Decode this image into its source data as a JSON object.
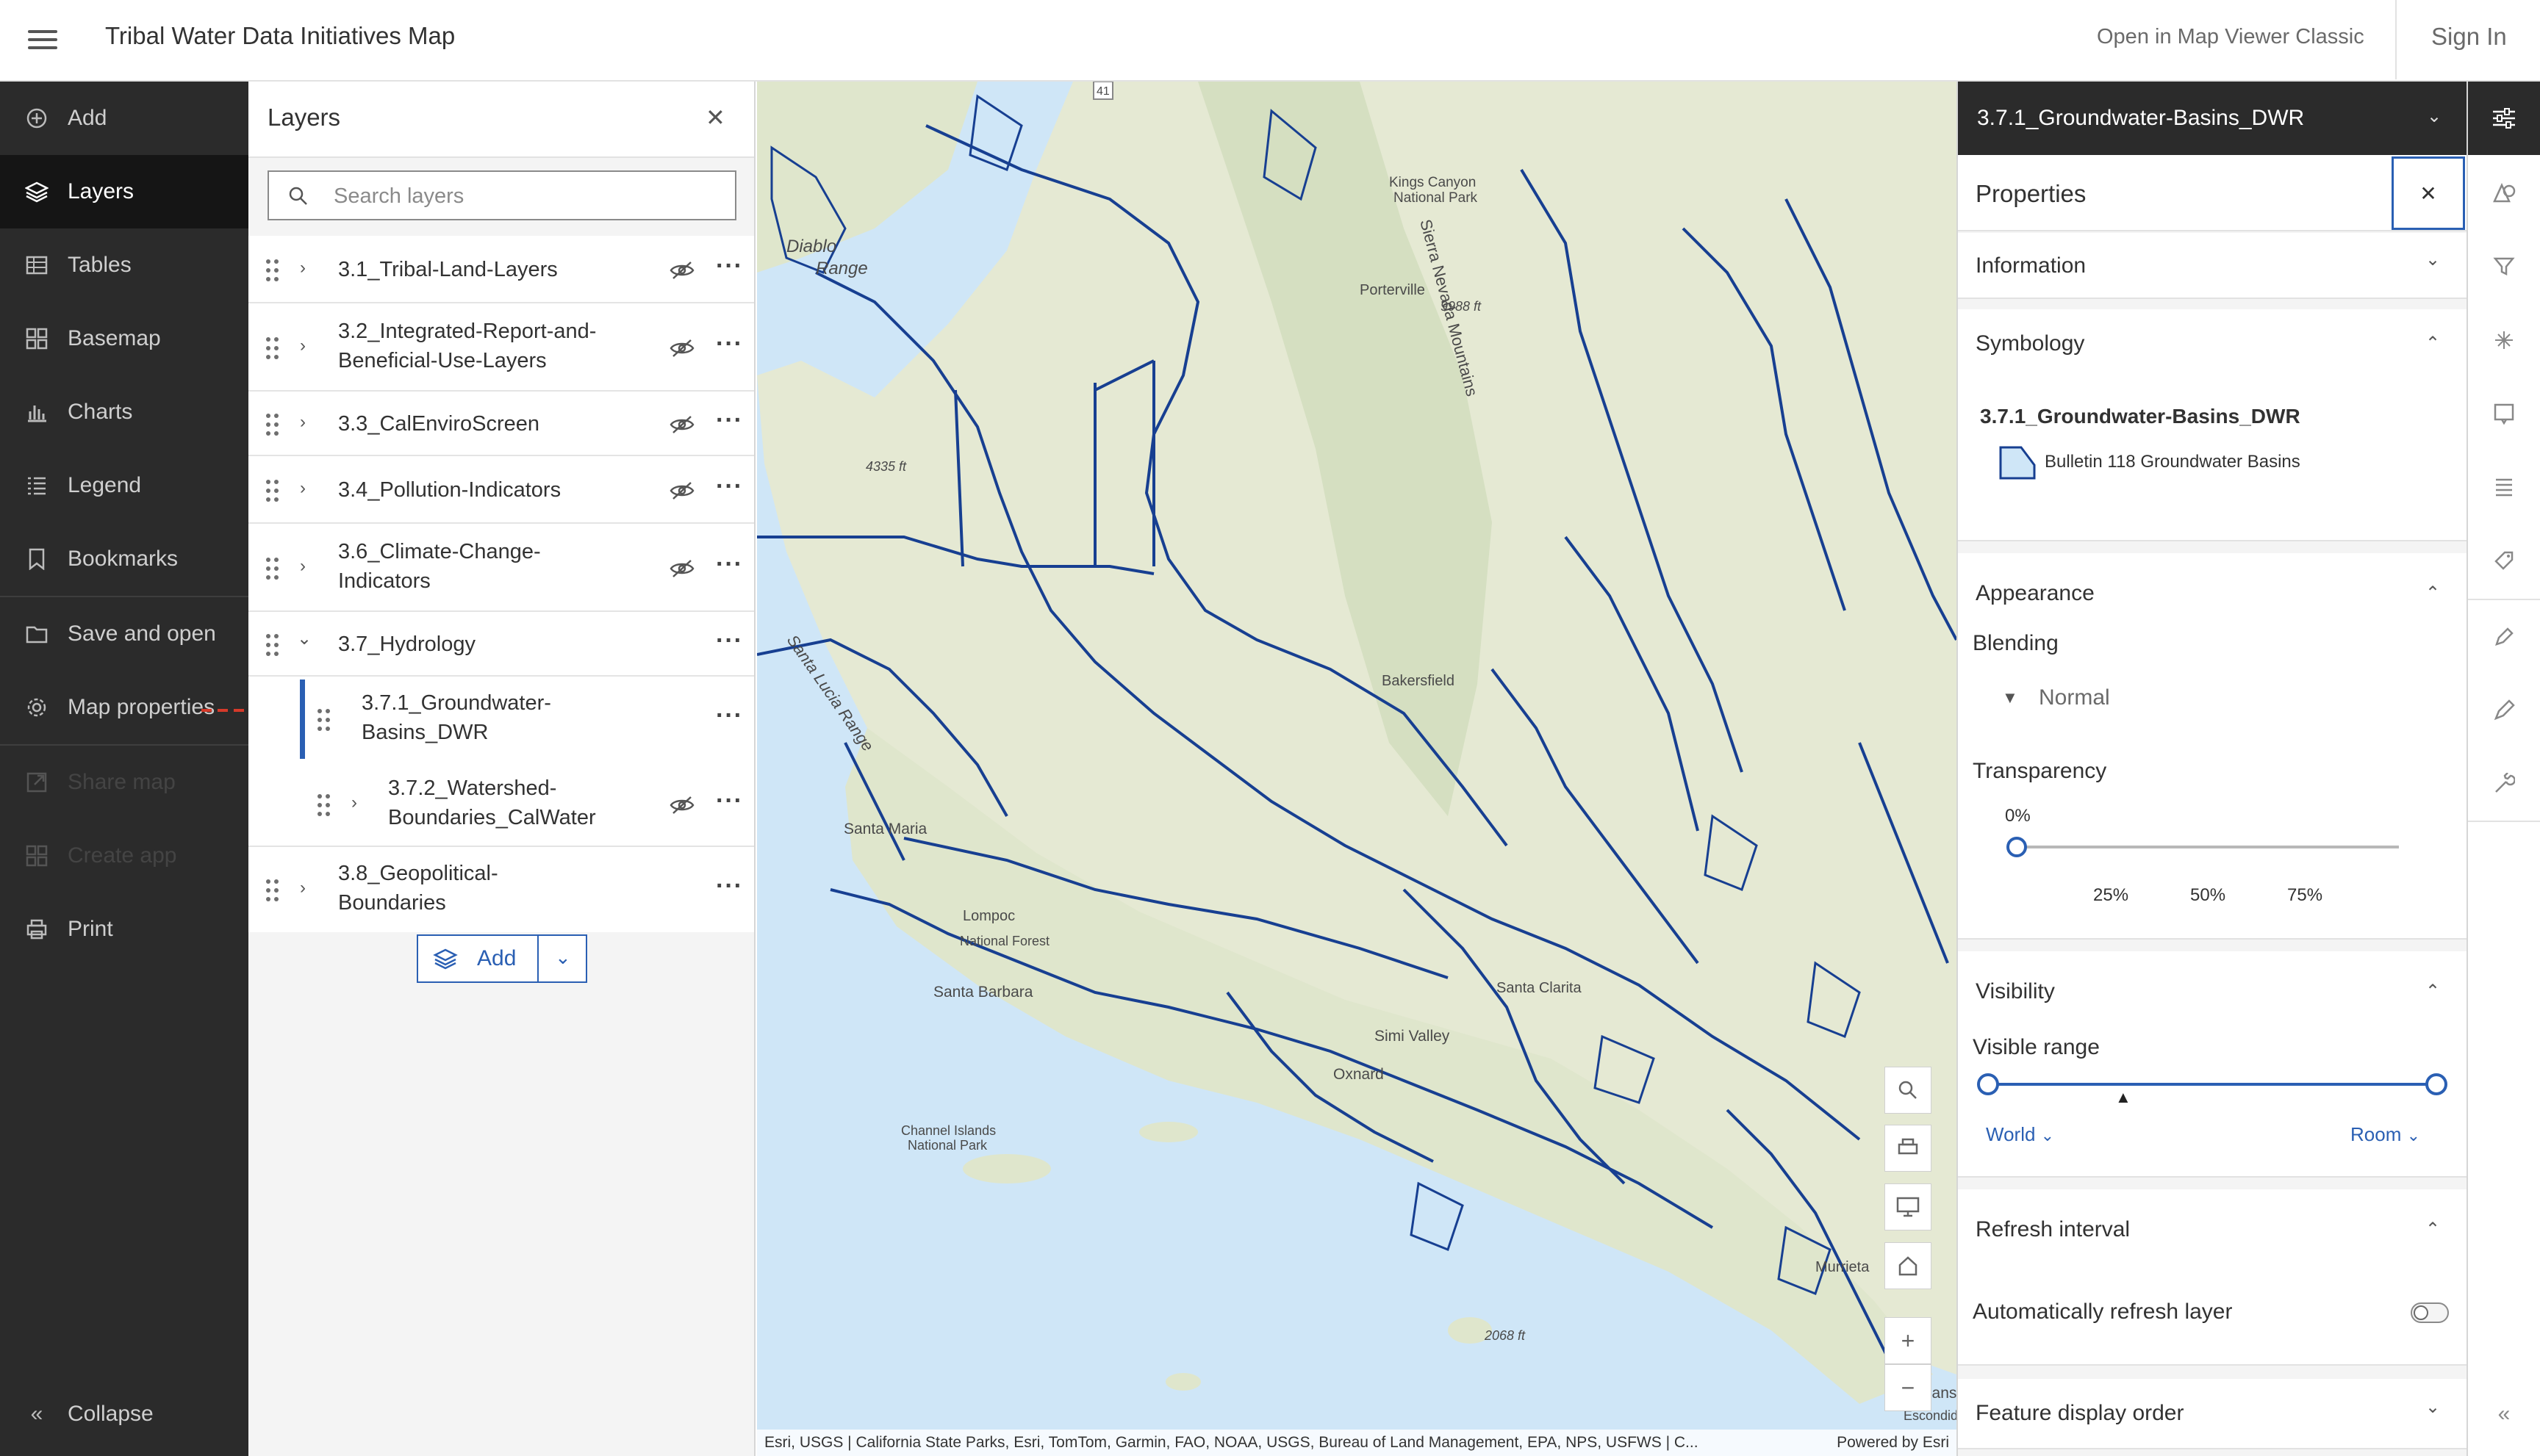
{
  "header": {
    "title": "Tribal Water Data Initiatives Map",
    "open_classic": "Open in Map Viewer Classic",
    "sign_in": "Sign In"
  },
  "nav": {
    "items": [
      {
        "label": "Add",
        "icon": "plus-circle-icon"
      },
      {
        "label": "Layers",
        "icon": "layers-icon"
      },
      {
        "label": "Tables",
        "icon": "table-icon"
      },
      {
        "label": "Basemap",
        "icon": "basemap-icon"
      },
      {
        "label": "Charts",
        "icon": "chart-icon"
      },
      {
        "label": "Legend",
        "icon": "legend-icon"
      },
      {
        "label": "Bookmarks",
        "icon": "bookmark-icon"
      },
      {
        "label": "Save and open",
        "icon": "folder-icon"
      },
      {
        "label": "Map properties",
        "icon": "gear-icon"
      },
      {
        "label": "Share map",
        "icon": "share-icon"
      },
      {
        "label": "Create app",
        "icon": "grid-icon"
      },
      {
        "label": "Print",
        "icon": "print-icon"
      }
    ],
    "collapse": "Collapse"
  },
  "layers_panel": {
    "title": "Layers",
    "search_placeholder": "Search layers",
    "layers": [
      {
        "name": "3.1_Tribal-Land-Layers"
      },
      {
        "name": "3.2_Integrated-Report-and-",
        "name2": "Beneficial-Use-Layers"
      },
      {
        "name": "3.3_CalEnviroScreen"
      },
      {
        "name": "3.4_Pollution-Indicators"
      },
      {
        "name": "3.6_Climate-Change-",
        "name2": "Indicators"
      },
      {
        "name": "3.7_Hydrology"
      },
      {
        "name": "3.7.1_Groundwater-",
        "name2": "Basins_DWR"
      },
      {
        "name": "3.7.2_Watershed-",
        "name2": "Boundaries_CalWater"
      },
      {
        "name": "3.8_Geopolitical-",
        "name2": "Boundaries"
      }
    ],
    "add_label": "Add"
  },
  "map": {
    "labels": [
      "Kings Canyon",
      "National Park",
      "Sierra Nevada Mountains",
      "Porterville",
      "9988 ft",
      "Diablo",
      "Range",
      "4335 ft",
      "Santa Lucia Range",
      "Santa Maria",
      "National Forest",
      "Santa Barbara",
      "Channel Islands",
      "National Park",
      "Simi Valley",
      "Oxnard",
      "2068 ft",
      "Oceanside",
      "Escondido",
      "Murrieta",
      "Bakersfield",
      "Lompoc",
      "Santa Clarita",
      "41"
    ],
    "attribution": "Esri, USGS | California State Parks, Esri, TomTom, Garmin, FAO, NOAA, USGS, Bureau of Land Management, EPA, NPS, USFWS | C...",
    "powered_by": "Powered by Esri"
  },
  "properties": {
    "layer_select": "3.7.1_Groundwater-Basins_DWR",
    "title": "Properties",
    "information": "Information",
    "symbology": "Symbology",
    "symbology_layer": "3.7.1_Groundwater-Basins_DWR",
    "symbology_item": "Bulletin 118 Groundwater Basins",
    "appearance": "Appearance",
    "blending": "Blending",
    "blending_value": "Normal",
    "transparency": "Transparency",
    "transparency_value": "0%",
    "ticks": [
      "25%",
      "50%",
      "75%"
    ],
    "visibility": "Visibility",
    "visible_range": "Visible range",
    "range_min": "World",
    "range_max": "Room",
    "refresh_interval": "Refresh interval",
    "auto_refresh": "Automatically refresh layer",
    "feature_display_order": "Feature display order"
  },
  "colors": {
    "accent": "#2a5fb3",
    "water": "#cfe6f7",
    "basin_line": "#173f91",
    "land": "#e8ead9",
    "nav_bg": "#2b2b2b"
  }
}
